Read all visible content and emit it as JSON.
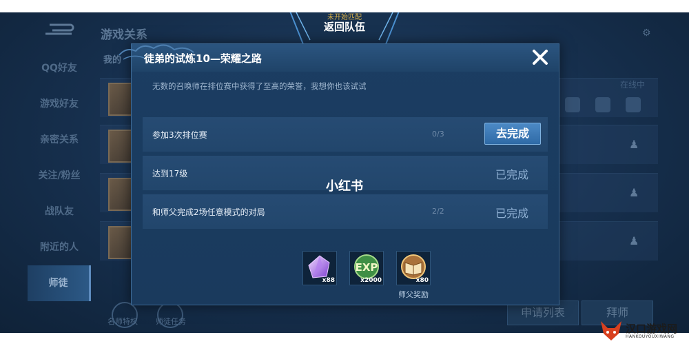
{
  "top_badge": {
    "subtitle": "未开始匹配",
    "title": "返回队伍"
  },
  "background": {
    "title": "游戏关系",
    "subtitle": "我的",
    "online_status": "在线中",
    "nav": [
      "QQ好友",
      "游戏好友",
      "亲密关系",
      "关注/粉丝",
      "战队友",
      "附近的人",
      "师徒"
    ],
    "active_nav": "师徒",
    "bottom_left_labels": [
      "名师特权",
      "师徒任务"
    ],
    "buttons": {
      "apply_list": "申请列表",
      "apprentice": "拜师"
    }
  },
  "dialog": {
    "title": "徒弟的试炼10—荣耀之路",
    "description": "无数的召唤师在排位赛中获得了至高的荣誉，我想你也该试试",
    "tasks": [
      {
        "label": "参加3次排位赛",
        "progress": "0/3",
        "status": "去完成",
        "done": false
      },
      {
        "label": "达到17级",
        "progress": "",
        "status": "已完成",
        "done": true
      },
      {
        "label": "和师父完成2场任意模式的对局",
        "progress": "2/2",
        "status": "已完成",
        "done": true
      }
    ],
    "rewards": [
      {
        "icon": "crystal-gem-icon",
        "count": "x88",
        "caption": ""
      },
      {
        "icon": "exp-badge-icon",
        "count": "x2000",
        "caption": ""
      },
      {
        "icon": "master-book-icon",
        "count": "x80",
        "caption": "师父奖励"
      }
    ]
  },
  "watermark": "小红书",
  "site_logo": {
    "name": "汉口游戏网",
    "sub": "HANKOUYOUXIWANG"
  },
  "colors": {
    "accent_button": "#3a78b5",
    "dialog_bg": "#1b3d62",
    "done_text": "#8fb0d3"
  }
}
